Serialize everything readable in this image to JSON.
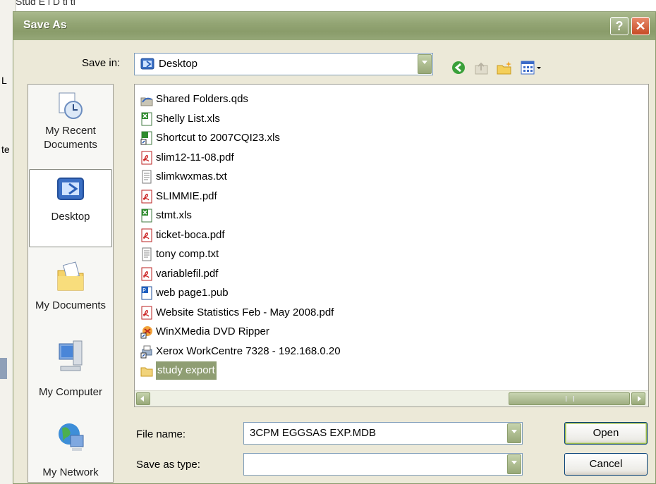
{
  "background": {
    "title_fragment": "Stud  E  l D  ti  ti",
    "left_text_1": "L",
    "left_text_2": "te"
  },
  "dialog": {
    "title": "Save As",
    "help_glyph": "?",
    "close_glyph": "✕"
  },
  "save_in": {
    "label": "Save in:",
    "value": "Desktop"
  },
  "toolbar": [
    "back-icon",
    "up-folder-icon",
    "new-folder-icon",
    "views-menu-icon"
  ],
  "places": [
    {
      "label": "My Recent Documents",
      "icon": "recent-documents-icon",
      "selected": false
    },
    {
      "label": "Desktop",
      "icon": "desktop-icon",
      "selected": true
    },
    {
      "label": "My Documents",
      "icon": "my-documents-icon",
      "selected": false
    },
    {
      "label": "My Computer",
      "icon": "my-computer-icon",
      "selected": false
    },
    {
      "label": "My Network",
      "icon": "my-network-icon",
      "selected": false
    }
  ],
  "files": [
    {
      "name": "Shared Folders.qds",
      "icon": "shared-folders-icon"
    },
    {
      "name": "Shelly List.xls",
      "icon": "excel-file-icon"
    },
    {
      "name": "Shortcut to 2007CQI23.xls",
      "icon": "excel-shortcut-icon"
    },
    {
      "name": "slim12-11-08.pdf",
      "icon": "pdf-file-icon"
    },
    {
      "name": "slimkwxmas.txt",
      "icon": "text-file-icon"
    },
    {
      "name": "SLIMMIE.pdf",
      "icon": "pdf-file-icon"
    },
    {
      "name": "stmt.xls",
      "icon": "excel-file-icon"
    },
    {
      "name": "ticket-boca.pdf",
      "icon": "pdf-file-icon"
    },
    {
      "name": "tony comp.txt",
      "icon": "text-file-icon"
    },
    {
      "name": "variablefil.pdf",
      "icon": "pdf-file-icon"
    },
    {
      "name": "web page1.pub",
      "icon": "publisher-file-icon"
    },
    {
      "name": "Website Statistics Feb - May 2008.pdf",
      "icon": "pdf-file-icon"
    },
    {
      "name": "WinXMedia DVD Ripper",
      "icon": "app-shortcut-icon"
    },
    {
      "name": "Xerox WorkCentre 7328 - 192.168.0.20",
      "icon": "printer-shortcut-icon"
    },
    {
      "name": "study export",
      "icon": "folder-icon",
      "selected": true
    }
  ],
  "file_name": {
    "label": "File name:",
    "value": "3CPM EGGSAS EXP.MDB"
  },
  "save_as_type": {
    "label": "Save as type:",
    "value": ""
  },
  "buttons": {
    "open": "Open",
    "cancel": "Cancel"
  },
  "colors": {
    "titlebar": "#93a574",
    "selection": "#8f9e73",
    "dialog_bg": "#ECE9D8"
  }
}
